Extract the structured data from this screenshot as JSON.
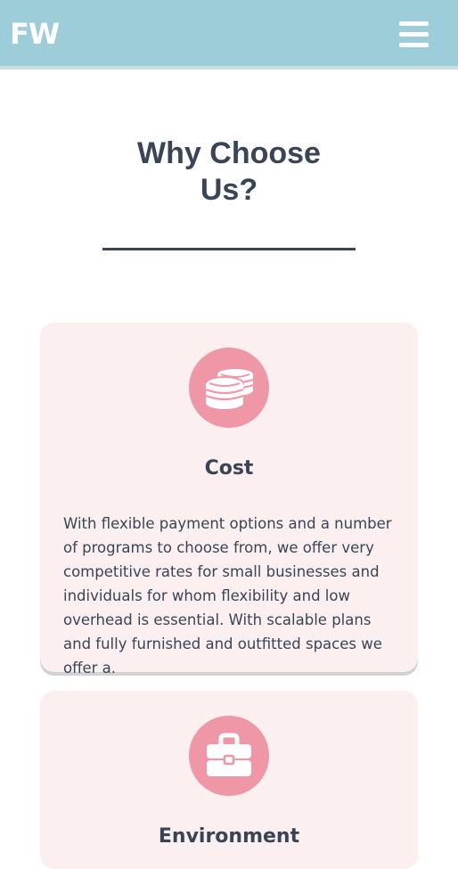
{
  "header": {
    "logo": "FW",
    "menu_icon": "hamburger-menu-icon",
    "background": "#9dcdd9"
  },
  "section": {
    "title_line1": "Why Choose",
    "title_line2": "Us?"
  },
  "cards": [
    {
      "icon": "coins-icon",
      "title": "Cost",
      "text": "With flexible payment options and a number of programs to choose from, we offer very competitive rates for small businesses and individuals for whom flexibility and low overhead is essential. With scalable plans and fully furnished and outfitted spaces we offer a."
    },
    {
      "icon": "briefcase-icon",
      "title": "Environment"
    }
  ],
  "colors": {
    "accent_pink": "#ef97a6",
    "card_bg": "#fbefef",
    "text_dark": "#3a4457"
  }
}
